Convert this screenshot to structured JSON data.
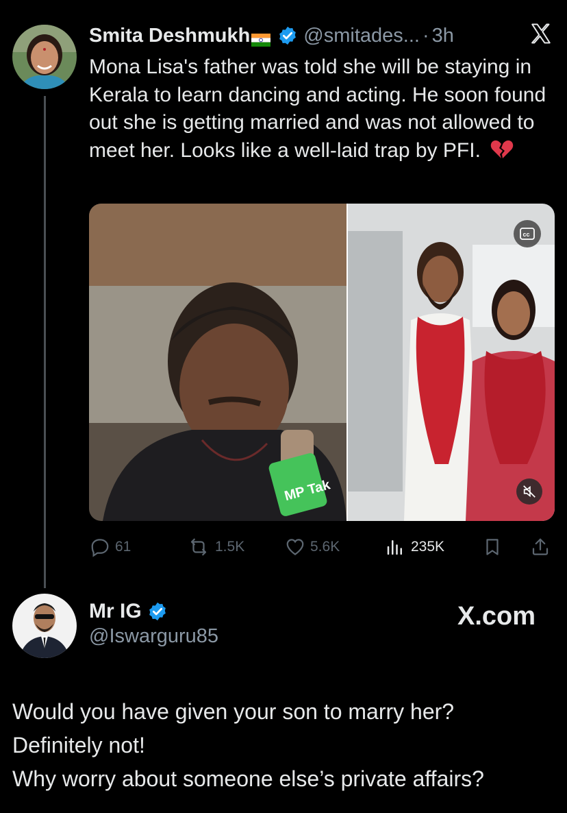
{
  "quoted_tweet": {
    "author_name": "Smita Deshmukh",
    "author_flag": "India flag",
    "handle": "@smitades...",
    "separator": "·",
    "time": "3h",
    "text": "Mona Lisa's father was told she will be staying in Kerala to learn dancing and acting. He soon found out she is getting married and was not allowed to meet her. Looks like a well-laid trap by PFI.",
    "emoji": "broken-heart-icon",
    "media_badge_left": "MP Tak",
    "stats": {
      "replies": "61",
      "reposts": "1.5K",
      "likes": "5.6K",
      "views": "235K"
    }
  },
  "reply_author": {
    "name": "Mr IG",
    "handle": "@Iswarguru85"
  },
  "watermark": "X.com",
  "comment_lines": [
    "Would you have given your son to marry her?",
    "Definitely not!",
    "Why worry about someone else’s private affairs?"
  ],
  "colors": {
    "background": "#000000",
    "text_primary": "#e7e9ea",
    "text_secondary": "#8b98a5",
    "verified_blue": "#1d9bf0",
    "icon_muted": "#5c6670"
  }
}
